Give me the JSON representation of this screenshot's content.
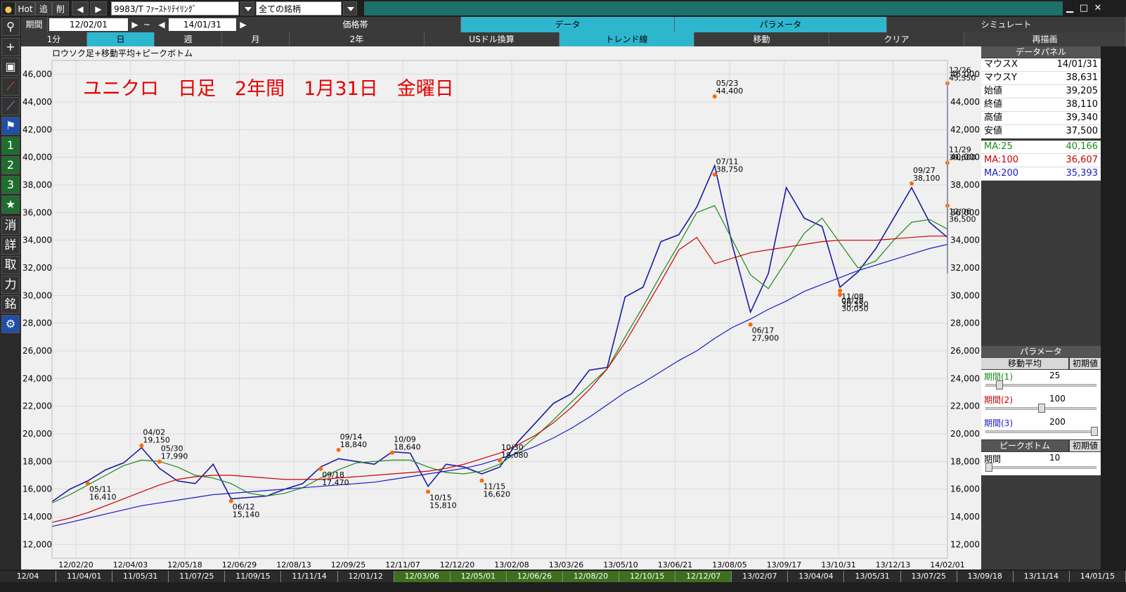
{
  "toolbar": {
    "hot_label": "Hot",
    "add_label": "追",
    "del_label": "削",
    "symbol": "9983/T ﾌｧｰｽﾄﾘﾃｲﾘﾝｸﾞ",
    "filter": "全ての銘柄",
    "prev_icon": "◀",
    "next_icon": "▶"
  },
  "period_bar": {
    "label": "期間",
    "start": "12/02/01",
    "tilde": "~",
    "end": "14/01/31",
    "tabs": [
      "価格帯",
      "データ",
      "パラメータ",
      "シミュレート"
    ],
    "selected_tab": "データ"
  },
  "timeframe_bar": {
    "items": [
      "1分",
      "日",
      "週",
      "月",
      "2年",
      "USドル換算",
      "トレンド線",
      "移動",
      "クリア",
      "再描画"
    ],
    "selected": "日"
  },
  "sidebar": {
    "icons": [
      "search-icon",
      "plus-icon",
      "camera-icon",
      "chart-red-icon",
      "chart-purple-icon",
      "flag-icon"
    ],
    "numbers": [
      "1",
      "2",
      "3"
    ],
    "star": "★",
    "chars": [
      "消",
      "詳",
      "取",
      "力",
      "銘"
    ],
    "gear": "⚙"
  },
  "chart_data": {
    "type": "line",
    "subtitle": "ロウソク足+移動平均+ピークボトム",
    "annotation": "ユニクロ　日足　2年間　1月31日　金曜日",
    "ylim": [
      11000,
      47000
    ],
    "y_ticks": [
      "46,000",
      "44,000",
      "42,000",
      "40,000",
      "38,000",
      "36,000",
      "34,000",
      "32,000",
      "30,000",
      "28,000",
      "26,000",
      "24,000",
      "22,000",
      "20,000",
      "18,000",
      "16,000",
      "14,000",
      "12,000"
    ],
    "x_ticks": [
      "12/02/20",
      "12/04/03",
      "12/05/18",
      "12/06/29",
      "12/08/13",
      "12/09/25",
      "12/11/07",
      "12/12/20",
      "13/02/08",
      "13/03/26",
      "13/05/10",
      "13/06/21",
      "13/08/05",
      "13/09/17",
      "13/10/31",
      "13/12/13",
      "14/02/01"
    ],
    "x": [
      0,
      10,
      20,
      30,
      40,
      50,
      60,
      70,
      80,
      90,
      100,
      110,
      120,
      130,
      140,
      150,
      160,
      170,
      180,
      190,
      200,
      210,
      220,
      230,
      240,
      250,
      260,
      270,
      280,
      290,
      300,
      310,
      320,
      330,
      340,
      350,
      360,
      370,
      380,
      390,
      400,
      410,
      420,
      430,
      440,
      450,
      460,
      470,
      480,
      490,
      500
    ],
    "series": [
      {
        "name": "Close",
        "color": "#1a1aa0",
        "values": [
          15100,
          16000,
          16600,
          17400,
          17900,
          19000,
          17500,
          16600,
          16400,
          17800,
          15300,
          15400,
          15500,
          16000,
          16400,
          17600,
          18200,
          18000,
          17800,
          18700,
          18600,
          16200,
          17800,
          17600,
          17100,
          17600,
          19400,
          20800,
          22200,
          22900,
          24600,
          24800,
          29900,
          30600,
          33900,
          34400,
          36400,
          39400,
          33600,
          28800,
          31600,
          37800,
          35600,
          35000,
          30600,
          31700,
          33400,
          35600,
          37800,
          35300,
          34200,
          33300,
          31600,
          33700,
          37100,
          39300,
          36800,
          38900,
          45300,
          40200,
          37900
        ]
      },
      {
        "name": "MA:25",
        "color": "#1a8a1a",
        "values": [
          15000,
          15600,
          16300,
          17000,
          17700,
          18100,
          18000,
          17600,
          17000,
          16800,
          16400,
          15700,
          15500,
          15700,
          16100,
          16800,
          17400,
          17900,
          18000,
          18100,
          18100,
          17600,
          17200,
          17100,
          17300,
          17800,
          18700,
          19800,
          21000,
          22300,
          23500,
          24700,
          27000,
          29200,
          31500,
          33700,
          36000,
          36500,
          34000,
          31500,
          30500,
          32500,
          34500,
          35600,
          33800,
          32000,
          32500,
          34000,
          35300,
          35500,
          34800,
          33600,
          32600,
          33000,
          35000,
          37500,
          38200,
          39000,
          40500,
          40200,
          40200
        ]
      },
      {
        "name": "MA:100",
        "color": "#cc0000",
        "values": [
          13600,
          13900,
          14300,
          14800,
          15300,
          15800,
          16300,
          16700,
          16900,
          17000,
          17000,
          16900,
          16800,
          16700,
          16700,
          16700,
          16800,
          16900,
          17000,
          17100,
          17200,
          17300,
          17500,
          17800,
          18200,
          18600,
          19200,
          19900,
          20800,
          21900,
          23200,
          24700,
          26600,
          28800,
          31000,
          33300,
          34200,
          32300,
          32700,
          33100,
          33300,
          33500,
          33700,
          33900,
          34000,
          34000,
          34000,
          34100,
          34200,
          34300,
          34300,
          34300,
          34200,
          34200,
          34400,
          34700,
          35100,
          35600,
          36100,
          36400,
          36600
        ]
      },
      {
        "name": "MA:200",
        "color": "#1a1acc",
        "values": [
          13300,
          13600,
          13900,
          14200,
          14500,
          14800,
          15000,
          15200,
          15400,
          15600,
          15700,
          15800,
          15900,
          16000,
          16100,
          16200,
          16300,
          16400,
          16500,
          16700,
          16900,
          17100,
          17300,
          17500,
          17800,
          18200,
          18600,
          19100,
          19700,
          20400,
          21200,
          22100,
          23000,
          23700,
          24500,
          25300,
          26000,
          26900,
          27700,
          28300,
          29000,
          29600,
          30300,
          30800,
          31300,
          31800,
          32200,
          32600,
          33000,
          33400,
          33700,
          34000,
          34300,
          34500,
          34700,
          35000,
          35100,
          35300,
          35400,
          35400,
          35400
        ]
      }
    ],
    "peaks": [
      {
        "date": "04/02",
        "value": "19,150",
        "pos": "top"
      },
      {
        "date": "05/11",
        "value": "16,410",
        "pos": "bottom"
      },
      {
        "date": "05/30",
        "value": "17,990",
        "pos": "top"
      },
      {
        "date": "06/12",
        "value": "15,140",
        "pos": "bottom"
      },
      {
        "date": "09/14",
        "value": "18,840",
        "pos": "top"
      },
      {
        "date": "09/18",
        "value": "17,470",
        "pos": "bottom"
      },
      {
        "date": "10/09",
        "value": "18,640",
        "pos": "top"
      },
      {
        "date": "10/15",
        "value": "15,810",
        "pos": "bottom"
      },
      {
        "date": "10/30",
        "value": "18,080",
        "pos": "top"
      },
      {
        "date": "11/15",
        "value": "16,620",
        "pos": "bottom"
      },
      {
        "date": "05/23",
        "value": "44,400",
        "pos": "top"
      },
      {
        "date": "06/17",
        "value": "27,900",
        "pos": "bottom"
      },
      {
        "date": "07/11",
        "value": "38,750",
        "pos": "top"
      },
      {
        "date": "08/28",
        "value": "30,050",
        "pos": "bottom"
      },
      {
        "date": "09/27",
        "value": "38,100",
        "pos": "top"
      },
      {
        "date": "11/08",
        "value": "30,350",
        "pos": "bottom"
      },
      {
        "date": "11/29",
        "value": "39,600",
        "pos": "top"
      },
      {
        "date": "12/06",
        "value": "36,500",
        "pos": "bottom"
      },
      {
        "date": "12/26",
        "value": "45,350",
        "pos": "top"
      }
    ]
  },
  "data_panel": {
    "title": "データパネル",
    "rows": [
      {
        "key": "マウスX",
        "value": "14/01/31"
      },
      {
        "key": "マウスY",
        "value": "38,631"
      },
      {
        "key": "始値",
        "value": "39,205"
      },
      {
        "key": "終値",
        "value": "38,110"
      },
      {
        "key": "高値",
        "value": "39,340"
      },
      {
        "key": "安値",
        "value": "37,500"
      },
      {
        "key": "MA:25",
        "value": "40,166",
        "color": "#1a8a1a"
      },
      {
        "key": "MA:100",
        "value": "36,607",
        "color": "#cc0000"
      },
      {
        "key": "MA:200",
        "value": "35,393",
        "color": "#1a1acc"
      }
    ]
  },
  "param_panel": {
    "title": "パラメータ",
    "section1": "移動平均",
    "reset": "初期値",
    "params": [
      {
        "label": "期間(1)",
        "value": "25",
        "color": "#1a8a1a",
        "level": 0.1
      },
      {
        "label": "期間(2)",
        "value": "100",
        "color": "#cc0000",
        "level": 0.5
      },
      {
        "label": "期間(3)",
        "value": "200",
        "color": "#1a1acc",
        "level": 1.0
      }
    ],
    "section2": "ピークボトム",
    "reset2": "初期値",
    "pb_label": "期間",
    "pb_value": "10",
    "pb_level": 0.0
  },
  "date_strip": [
    "12/04",
    "11/04/01",
    "11/05/31",
    "11/07/25",
    "11/09/15",
    "11/11/14",
    "12/01/12",
    "12/03/06",
    "12/05/01",
    "12/06/26",
    "12/08/20",
    "12/10/15",
    "12/12/07",
    "13/02/07",
    "13/04/04",
    "13/05/31",
    "13/07/25",
    "13/09/18",
    "13/11/14",
    "14/01/15"
  ]
}
